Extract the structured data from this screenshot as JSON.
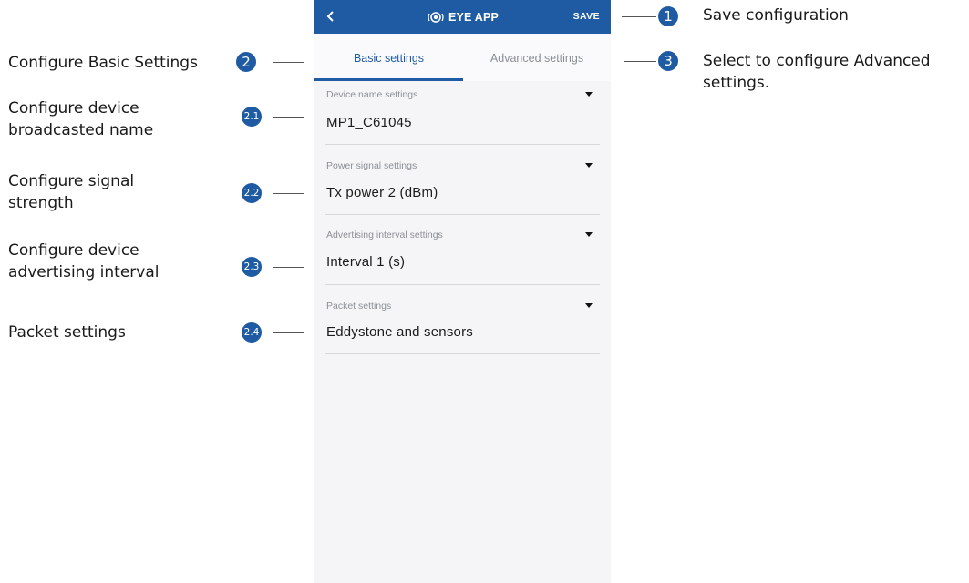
{
  "app": {
    "title": "EYE APP",
    "back_icon": "chevron-left-icon",
    "logo_icon": "eye-logo-icon",
    "save_label": "SAVE",
    "brand_color": "#1f5ba3"
  },
  "tabs": [
    {
      "label": "Basic settings",
      "active": true
    },
    {
      "label": "Advanced settings",
      "active": false
    }
  ],
  "settings": [
    {
      "label": "Device name settings",
      "value": "MP1_C61045"
    },
    {
      "label": "Power signal settings",
      "value": "Tx power 2 (dBm)"
    },
    {
      "label": "Advertising interval settings",
      "value": "Interval 1 (s)"
    },
    {
      "label": "Packet settings",
      "value": "Eddystone and sensors"
    }
  ],
  "annotations": {
    "left": [
      {
        "badge": "2",
        "text": "Configure Basic Settings"
      },
      {
        "badge": "2.1",
        "line1": "Configure device",
        "line2": "broadcasted name"
      },
      {
        "badge": "2.2",
        "line1": "Configure signal",
        "line2": "strength"
      },
      {
        "badge": "2.3",
        "line1": "Configure device",
        "line2": "advertising interval"
      },
      {
        "badge": "2.4",
        "text": "Packet settings"
      }
    ],
    "right": [
      {
        "badge": "1",
        "text": "Save configuration"
      },
      {
        "badge": "3",
        "line1": "Select to configure Advanced",
        "line2": "settings."
      }
    ]
  }
}
